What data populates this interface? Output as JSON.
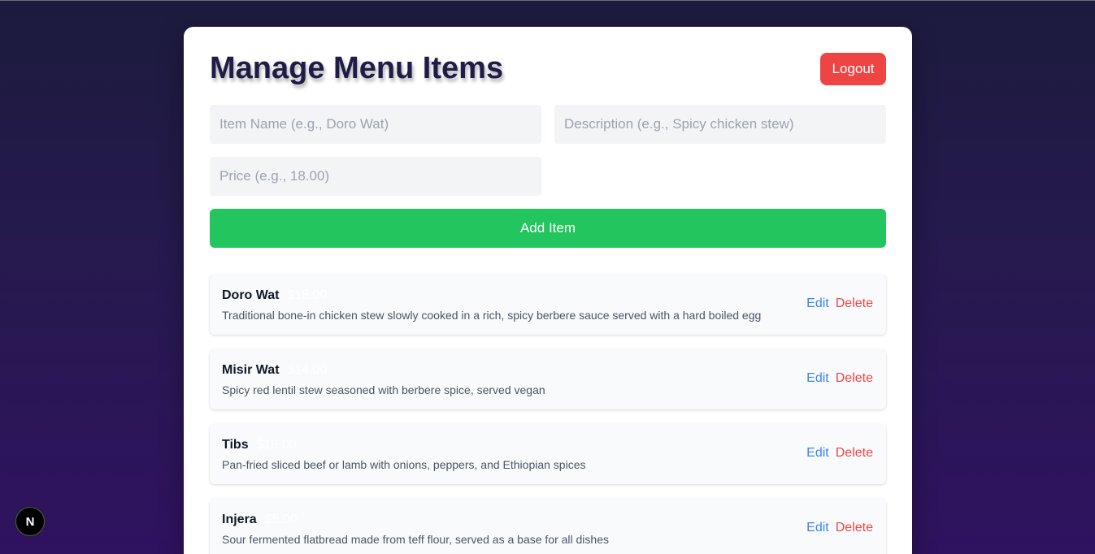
{
  "page": {
    "title": "Manage Menu Items",
    "logout_label": "Logout"
  },
  "form": {
    "name_placeholder": "Item Name (e.g., Doro Wat)",
    "description_placeholder": "Description (e.g., Spicy chicken stew)",
    "price_placeholder": "Price (e.g., 18.00)",
    "add_label": "Add Item"
  },
  "items": [
    {
      "name": "Doro Wat",
      "price": "$18.00",
      "description": "Traditional bone-in chicken stew slowly cooked in a rich, spicy berbere sauce served with a hard boiled egg",
      "edit_label": "Edit",
      "delete_label": "Delete"
    },
    {
      "name": "Misir Wat",
      "price": "$14.00",
      "description": "Spicy red lentil stew seasoned with berbere spice, served vegan",
      "edit_label": "Edit",
      "delete_label": "Delete"
    },
    {
      "name": "Tibs",
      "price": "$16.00",
      "description": "Pan-fried sliced beef or lamb with onions, peppers, and Ethiopian spices",
      "edit_label": "Edit",
      "delete_label": "Delete"
    },
    {
      "name": "Injera",
      "price": "$5.00",
      "description": "Sour fermented flatbread made from teff flour, served as a base for all dishes",
      "edit_label": "Edit",
      "delete_label": "Delete"
    }
  ],
  "dev_badge": {
    "letter": "N",
    "icon": "nextjs-logo-icon"
  },
  "colors": {
    "logout": "#ef4444",
    "add": "#22c55e",
    "edit": "#3b82f6",
    "delete": "#ef4444",
    "title": "#1f1d48"
  }
}
